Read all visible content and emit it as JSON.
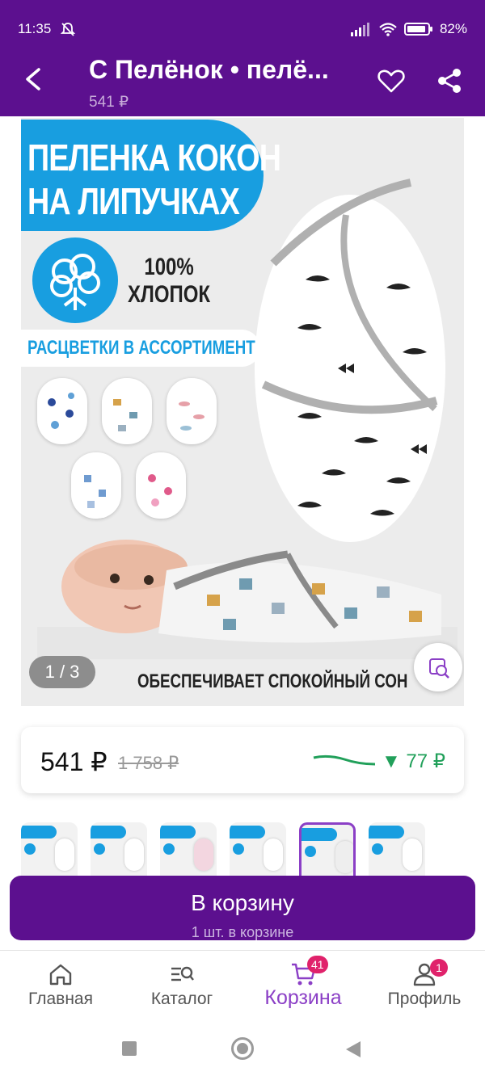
{
  "status_bar": {
    "time": "11:35",
    "battery": "82%"
  },
  "header": {
    "title": "С Пелёнок • пелё...",
    "subtitle_price": "541 ₽"
  },
  "gallery": {
    "banner_line1": "ПЕЛЕНКА КОКОН",
    "banner_line2": "НА ЛИПУЧКАХ",
    "cotton_line1": "100%",
    "cotton_line2": "ХЛОПОК",
    "assortment": "РАСЦВЕТКИ В АССОРТИМЕНТЕ",
    "slogan": "ОБЕСПЕЧИВАЕТ СПОКОЙНЫЙ СОН",
    "pager": "1 / 3"
  },
  "price_card": {
    "price": "541 ₽",
    "old_price": "1 758 ₽",
    "drop": "▼ 77 ₽"
  },
  "cart_button": {
    "label": "В корзину",
    "sub": "1 шт. в корзине"
  },
  "tabs": [
    {
      "label": "Главная",
      "icon": "home-icon"
    },
    {
      "label": "Каталог",
      "icon": "catalog-search-icon"
    },
    {
      "label": "Корзина",
      "icon": "cart-icon",
      "badge": "41"
    },
    {
      "label": "Профиль",
      "icon": "profile-icon",
      "badge": "1"
    }
  ],
  "colors": {
    "brand": "#5c108f",
    "accent": "#8b3fc6",
    "blue": "#189ee0",
    "green": "#21a05a",
    "badge": "#e0226b"
  }
}
